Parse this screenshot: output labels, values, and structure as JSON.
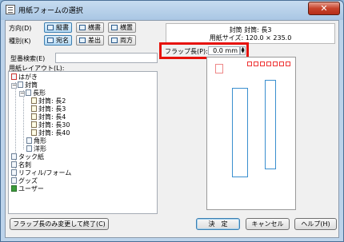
{
  "window": {
    "title": "用紙フォームの選択",
    "close_label": "✕"
  },
  "direction": {
    "label": "方向(D)",
    "options": [
      "縦書",
      "横書",
      "横置"
    ]
  },
  "kind": {
    "label": "種別(K)",
    "options": [
      "宛名",
      "差出",
      "両方"
    ]
  },
  "info": {
    "line1": "封筒 封筒: 長3",
    "line2": "用紙サイズ: 120.0 × 235.0"
  },
  "model_search": {
    "label": "型番検索(E)",
    "value": ""
  },
  "layout": {
    "label": "用紙レイアウト(L):"
  },
  "tree": [
    {
      "label": "はがき",
      "icon": "red-postcard-icon"
    },
    {
      "label": "封筒",
      "icon": "envelope-icon",
      "expanded": true
    },
    {
      "label": "長形",
      "icon": "folder-icon",
      "expanded": true
    },
    {
      "label": "封筒: 長2",
      "icon": "doc-icon"
    },
    {
      "label": "封筒: 長3",
      "icon": "doc-icon"
    },
    {
      "label": "封筒: 長4",
      "icon": "doc-icon"
    },
    {
      "label": "封筒: 長30",
      "icon": "doc-icon"
    },
    {
      "label": "封筒: 長40",
      "icon": "doc-icon"
    },
    {
      "label": "角形",
      "icon": "folder-icon"
    },
    {
      "label": "洋形",
      "icon": "folder-icon"
    },
    {
      "label": "タック紙",
      "icon": "label-sheet-icon"
    },
    {
      "label": "名刺",
      "icon": "card-icon"
    },
    {
      "label": "リフィル/フォーム",
      "icon": "refill-icon"
    },
    {
      "label": "グッズ",
      "icon": "goods-icon"
    },
    {
      "label": "ユーザー",
      "icon": "user-icon"
    }
  ],
  "flap": {
    "label": "フラップ長(P):",
    "value": "0.0 mm"
  },
  "buttons": {
    "flap_only": "フラップ長のみ変更して終了(C)",
    "ok": "決　定",
    "cancel": "キャンセル",
    "help": "ヘルプ(H)"
  }
}
